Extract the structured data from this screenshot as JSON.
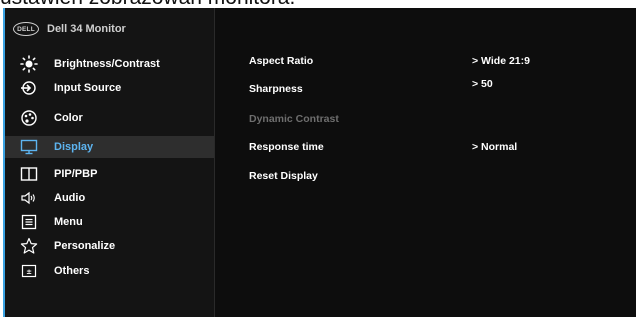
{
  "page_heading": "ustawień zobrazowań monitora.",
  "brand": {
    "logo_text": "DELL",
    "title": "Dell 34 Monitor"
  },
  "colors": {
    "accent": "#5db4f0",
    "background": "#0d0d0d",
    "active_bg": "#2e2e2e",
    "border": "#3aa3e3"
  },
  "menu": [
    {
      "label": "Brightness/Contrast",
      "icon": "brightness-icon"
    },
    {
      "label": "Input Source",
      "icon": "input-source-icon"
    },
    {
      "label": "Color",
      "icon": "color-icon"
    },
    {
      "label": "Display",
      "icon": "display-icon",
      "active": true
    },
    {
      "label": "PIP/PBP",
      "icon": "pip-pbp-icon"
    },
    {
      "label": "Audio",
      "icon": "audio-icon"
    },
    {
      "label": "Menu",
      "icon": "menu-icon"
    },
    {
      "label": "Personalize",
      "icon": "star-icon"
    },
    {
      "label": "Others",
      "icon": "others-icon"
    }
  ],
  "settings": [
    {
      "label": "Aspect Ratio",
      "value": "> Wide 21:9"
    },
    {
      "label": "Sharpness",
      "value": "> 50"
    },
    {
      "label": "Dynamic Contrast",
      "value": "",
      "disabled": true
    },
    {
      "label": "Response time",
      "value": "> Normal"
    },
    {
      "label": "Reset Display",
      "value": ""
    }
  ]
}
